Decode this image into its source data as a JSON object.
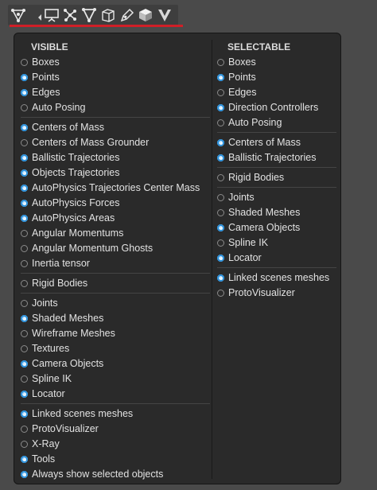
{
  "toolbar": {
    "icons": [
      "vertex-select-icon",
      "screen-icon",
      "nodes-icon",
      "vertex-triangle-icon",
      "cube-wire-icon",
      "pen-icon",
      "cube-solid-icon",
      "logo-v-icon"
    ]
  },
  "visible": {
    "header": "VISIBLE",
    "groups": [
      [
        {
          "label": "Boxes",
          "on": false
        },
        {
          "label": "Points",
          "on": true
        },
        {
          "label": "Edges",
          "on": true
        },
        {
          "label": "Auto Posing",
          "on": false
        }
      ],
      [
        {
          "label": "Centers of Mass",
          "on": true
        },
        {
          "label": "Centers of Mass Grounder",
          "on": false
        },
        {
          "label": "Ballistic Trajectories",
          "on": true
        },
        {
          "label": "Objects Trajectories",
          "on": true
        },
        {
          "label": "AutoPhysics Trajectories Center Mass",
          "on": true
        },
        {
          "label": "AutoPhysics Forces",
          "on": true
        },
        {
          "label": "AutoPhysics Areas",
          "on": true
        },
        {
          "label": "Angular Momentums",
          "on": false
        },
        {
          "label": "Angular Momentum Ghosts",
          "on": false
        },
        {
          "label": "Inertia tensor",
          "on": false
        }
      ],
      [
        {
          "label": "Rigid Bodies",
          "on": false
        }
      ],
      [
        {
          "label": "Joints",
          "on": false
        },
        {
          "label": "Shaded Meshes",
          "on": true
        },
        {
          "label": "Wireframe Meshes",
          "on": false
        },
        {
          "label": "Textures",
          "on": false
        },
        {
          "label": "Camera Objects",
          "on": true
        },
        {
          "label": "Spline IK",
          "on": false
        },
        {
          "label": "Locator",
          "on": true
        }
      ],
      [
        {
          "label": "Linked scenes meshes",
          "on": true
        },
        {
          "label": "ProtoVisualizer",
          "on": false
        },
        {
          "label": "X-Ray",
          "on": false
        },
        {
          "label": "Tools",
          "on": true
        },
        {
          "label": "Always show selected objects",
          "on": true
        }
      ]
    ]
  },
  "selectable": {
    "header": "SELECTABLE",
    "groups": [
      [
        {
          "label": "Boxes",
          "on": false
        },
        {
          "label": "Points",
          "on": true
        },
        {
          "label": "Edges",
          "on": false
        },
        {
          "label": "Direction Controllers",
          "on": true
        },
        {
          "label": "Auto Posing",
          "on": false
        }
      ],
      [
        {
          "label": "Centers of Mass",
          "on": true
        },
        {
          "label": "Ballistic Trajectories",
          "on": true
        }
      ],
      [
        {
          "label": "Rigid Bodies",
          "on": false
        }
      ],
      [
        {
          "label": "Joints",
          "on": false
        },
        {
          "label": "Shaded Meshes",
          "on": false
        },
        {
          "label": "Camera Objects",
          "on": true
        },
        {
          "label": "Spline IK",
          "on": false
        },
        {
          "label": "Locator",
          "on": true
        }
      ],
      [
        {
          "label": "Linked scenes meshes",
          "on": true
        },
        {
          "label": "ProtoVisualizer",
          "on": false
        }
      ]
    ]
  }
}
